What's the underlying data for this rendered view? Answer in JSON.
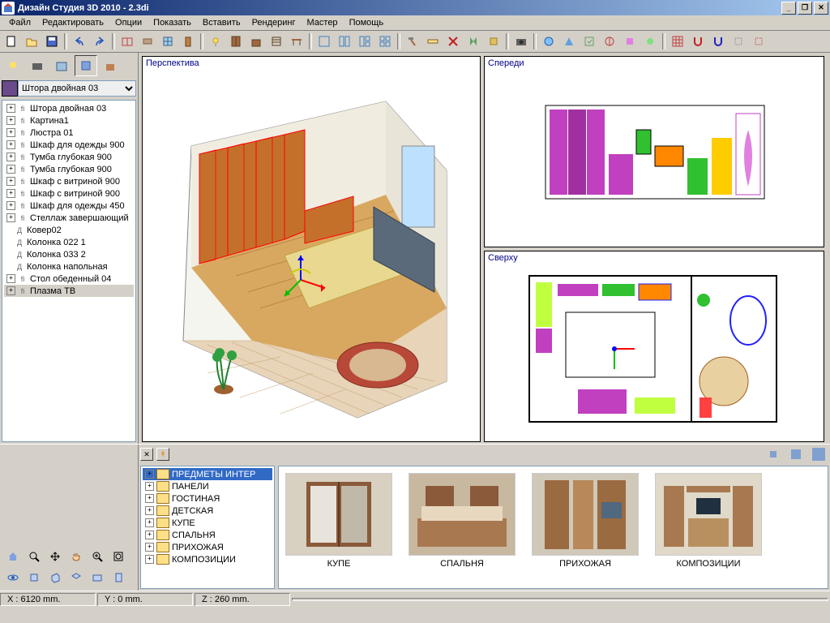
{
  "window": {
    "title": "Дизайн Студия 3D 2010 - 2.3di"
  },
  "menu": [
    "Файл",
    "Редактировать",
    "Опции",
    "Показать",
    "Вставить",
    "Рендеринг",
    "Мастер",
    "Помощь"
  ],
  "combo": {
    "selected": "Штора двойная 03"
  },
  "scene_tree": [
    {
      "exp": true,
      "icon": "ﬁ",
      "label": "Штора двойная 03"
    },
    {
      "exp": true,
      "icon": "ﬁ",
      "label": "Картина1"
    },
    {
      "exp": true,
      "icon": "ﬁ",
      "label": "Люстра 01"
    },
    {
      "exp": true,
      "icon": "ﬁ",
      "label": "Шкаф для одежды 900"
    },
    {
      "exp": true,
      "icon": "ﬁ",
      "label": "Тумба глубокая 900"
    },
    {
      "exp": true,
      "icon": "ﬁ",
      "label": "Тумба глубокая 900"
    },
    {
      "exp": true,
      "icon": "ﬁ",
      "label": "Шкаф с витриной 900"
    },
    {
      "exp": true,
      "icon": "ﬁ",
      "label": "Шкаф с витриной 900"
    },
    {
      "exp": true,
      "icon": "ﬁ",
      "label": "Шкаф для одежды 450"
    },
    {
      "exp": true,
      "icon": "ﬁ",
      "label": "Стеллаж завершающий"
    },
    {
      "exp": false,
      "icon": "Д",
      "label": "Ковер02"
    },
    {
      "exp": false,
      "icon": "Д",
      "label": "Колонка 022 1"
    },
    {
      "exp": false,
      "icon": "Д",
      "label": "Колонка 033 2"
    },
    {
      "exp": false,
      "icon": "Д",
      "label": "Колонка напольная"
    },
    {
      "exp": true,
      "icon": "ﬁ",
      "label": "Стол обеденный 04"
    },
    {
      "exp": true,
      "icon": "ﬁ",
      "label": "Плазма ТВ",
      "sel": true
    }
  ],
  "viewports": {
    "perspective": "Перспектива",
    "front": "Спереди",
    "top": "Сверху"
  },
  "catalog_tree": [
    {
      "label": "ПРЕДМЕТЫ ИНТЕР",
      "sel": true
    },
    {
      "label": "ПАНЕЛИ"
    },
    {
      "label": "ГОСТИНАЯ"
    },
    {
      "label": "ДЕТСКАЯ"
    },
    {
      "label": "КУПЕ"
    },
    {
      "label": "СПАЛЬНЯ"
    },
    {
      "label": "ПРИХОЖАЯ"
    },
    {
      "label": "КОМПОЗИЦИИ"
    }
  ],
  "thumbs": [
    "КУПЕ",
    "СПАЛЬНЯ",
    "ПРИХОЖАЯ",
    "КОМПОЗИЦИИ"
  ],
  "status": {
    "x": "X : 6120 mm.",
    "y": "Y : 0 mm.",
    "z": "Z : 260 mm."
  }
}
